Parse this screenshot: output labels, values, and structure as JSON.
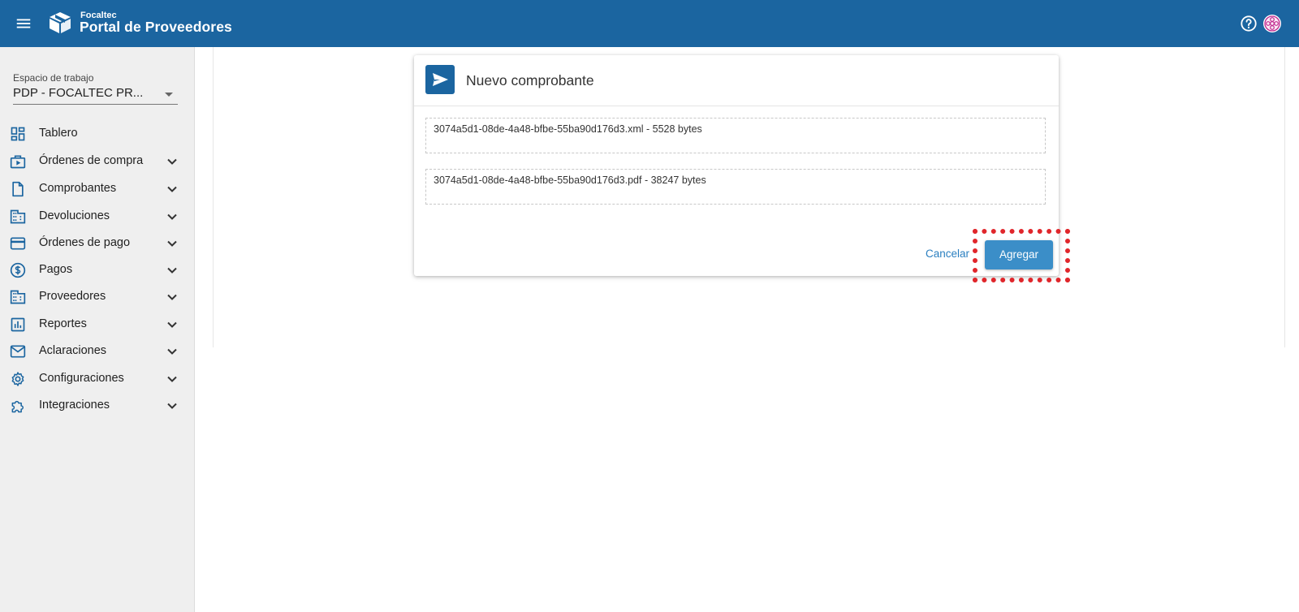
{
  "header": {
    "brand_small": "Focaltec",
    "brand_title": "Portal de Proveedores",
    "menu_icon": "hamburger-menu-icon",
    "logo_icon": "box-logo-icon",
    "help_icon": "help-circle-icon",
    "avatar_icon": "user-avatar-icon",
    "background_color": "#1b65a0"
  },
  "sidebar": {
    "workspace_label": "Espacio de trabajo",
    "workspace_value": "PDP - FOCALTEC PR...",
    "items": [
      {
        "label": "Tablero",
        "icon": "dashboard-icon",
        "expandable": false
      },
      {
        "label": "Órdenes de compra",
        "icon": "purchase-orders-icon",
        "expandable": true
      },
      {
        "label": "Comprobantes",
        "icon": "document-icon",
        "expandable": true
      },
      {
        "label": "Devoluciones",
        "icon": "building-icon",
        "expandable": true
      },
      {
        "label": "Órdenes de pago",
        "icon": "credit-card-icon",
        "expandable": true
      },
      {
        "label": "Pagos",
        "icon": "dollar-circle-icon",
        "expandable": true
      },
      {
        "label": "Proveedores",
        "icon": "building-icon",
        "expandable": true
      },
      {
        "label": "Reportes",
        "icon": "bar-chart-icon",
        "expandable": true
      },
      {
        "label": "Aclaraciones",
        "icon": "mail-icon",
        "expandable": true
      },
      {
        "label": "Configuraciones",
        "icon": "gear-icon",
        "expandable": true
      },
      {
        "label": "Integraciones",
        "icon": "puzzle-icon",
        "expandable": true
      }
    ]
  },
  "dialog": {
    "title": "Nuevo comprobante",
    "icon": "send-icon",
    "files": [
      "3074a5d1-08de-4a48-bfbe-55ba90d176d3.xml - 5528 bytes",
      "3074a5d1-08de-4a48-bfbe-55ba90d176d3.pdf - 38247 bytes"
    ],
    "cancel_label": "Cancelar",
    "add_label": "Agregar"
  },
  "colors": {
    "primary": "#1b65a0",
    "button": "#3b8ec8",
    "highlight": "#e0262b"
  }
}
